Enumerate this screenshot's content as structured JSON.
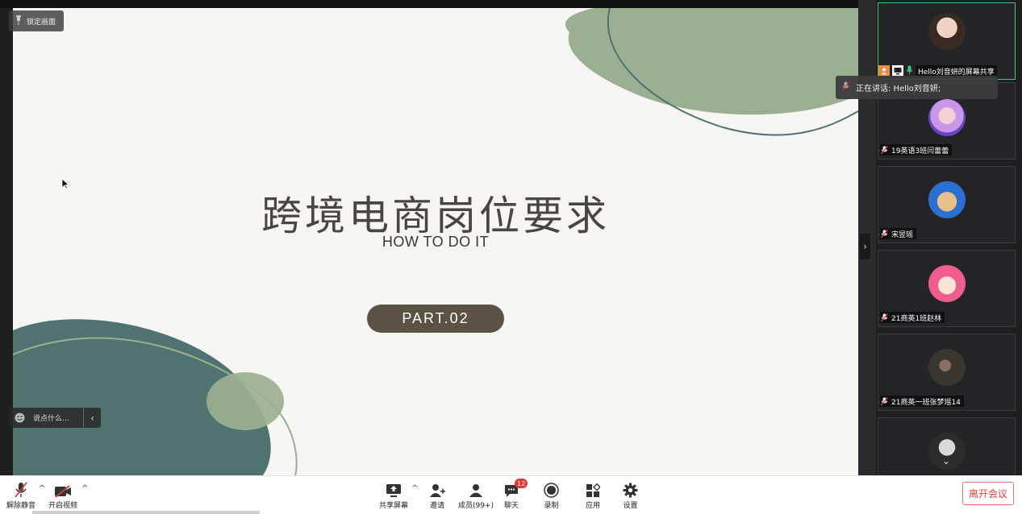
{
  "slide": {
    "title": "跨境电商岗位要求",
    "subtitle": "HOW TO DO IT",
    "part_label": "PART.02"
  },
  "overlay": {
    "lock_label": "锁定画面",
    "say_placeholder": "说点什么...",
    "speaking_text": "正在讲话: Hello刘音妍;"
  },
  "participants": [
    {
      "name": "Hello刘音妍的屏幕共享",
      "avatar_icon": "girl-photo-avatar",
      "active": true
    },
    {
      "name": "19英语3班闫蕾蕾",
      "avatar_icon": "pink-hair-avatar",
      "active": false
    },
    {
      "name": "宋昱瑶",
      "avatar_icon": "cartoon-face-avatar",
      "active": false
    },
    {
      "name": "21商英1班赵林",
      "avatar_icon": "pink-cartoon-avatar",
      "active": false
    },
    {
      "name": "21商英一班张梦瑶14",
      "avatar_icon": "dark-photo-avatar",
      "active": false
    },
    {
      "name": "",
      "avatar_icon": "anime-avatar",
      "active": false
    }
  ],
  "toolbar": {
    "unmute_label": "解除静音",
    "video_label": "开启视频",
    "share_label": "共享屏幕",
    "invite_label": "邀请",
    "members_label": "成员(99+)",
    "chat_label": "聊天",
    "chat_badge": "12",
    "record_label": "录制",
    "apps_label": "应用",
    "settings_label": "设置",
    "leave_label": "离开会议"
  },
  "colors": {
    "accent_red": "#e53935",
    "sage_green": "#9bb093",
    "teal": "#4f7470",
    "pill_brown": "#5c5244",
    "active_border": "#4ec27c"
  }
}
